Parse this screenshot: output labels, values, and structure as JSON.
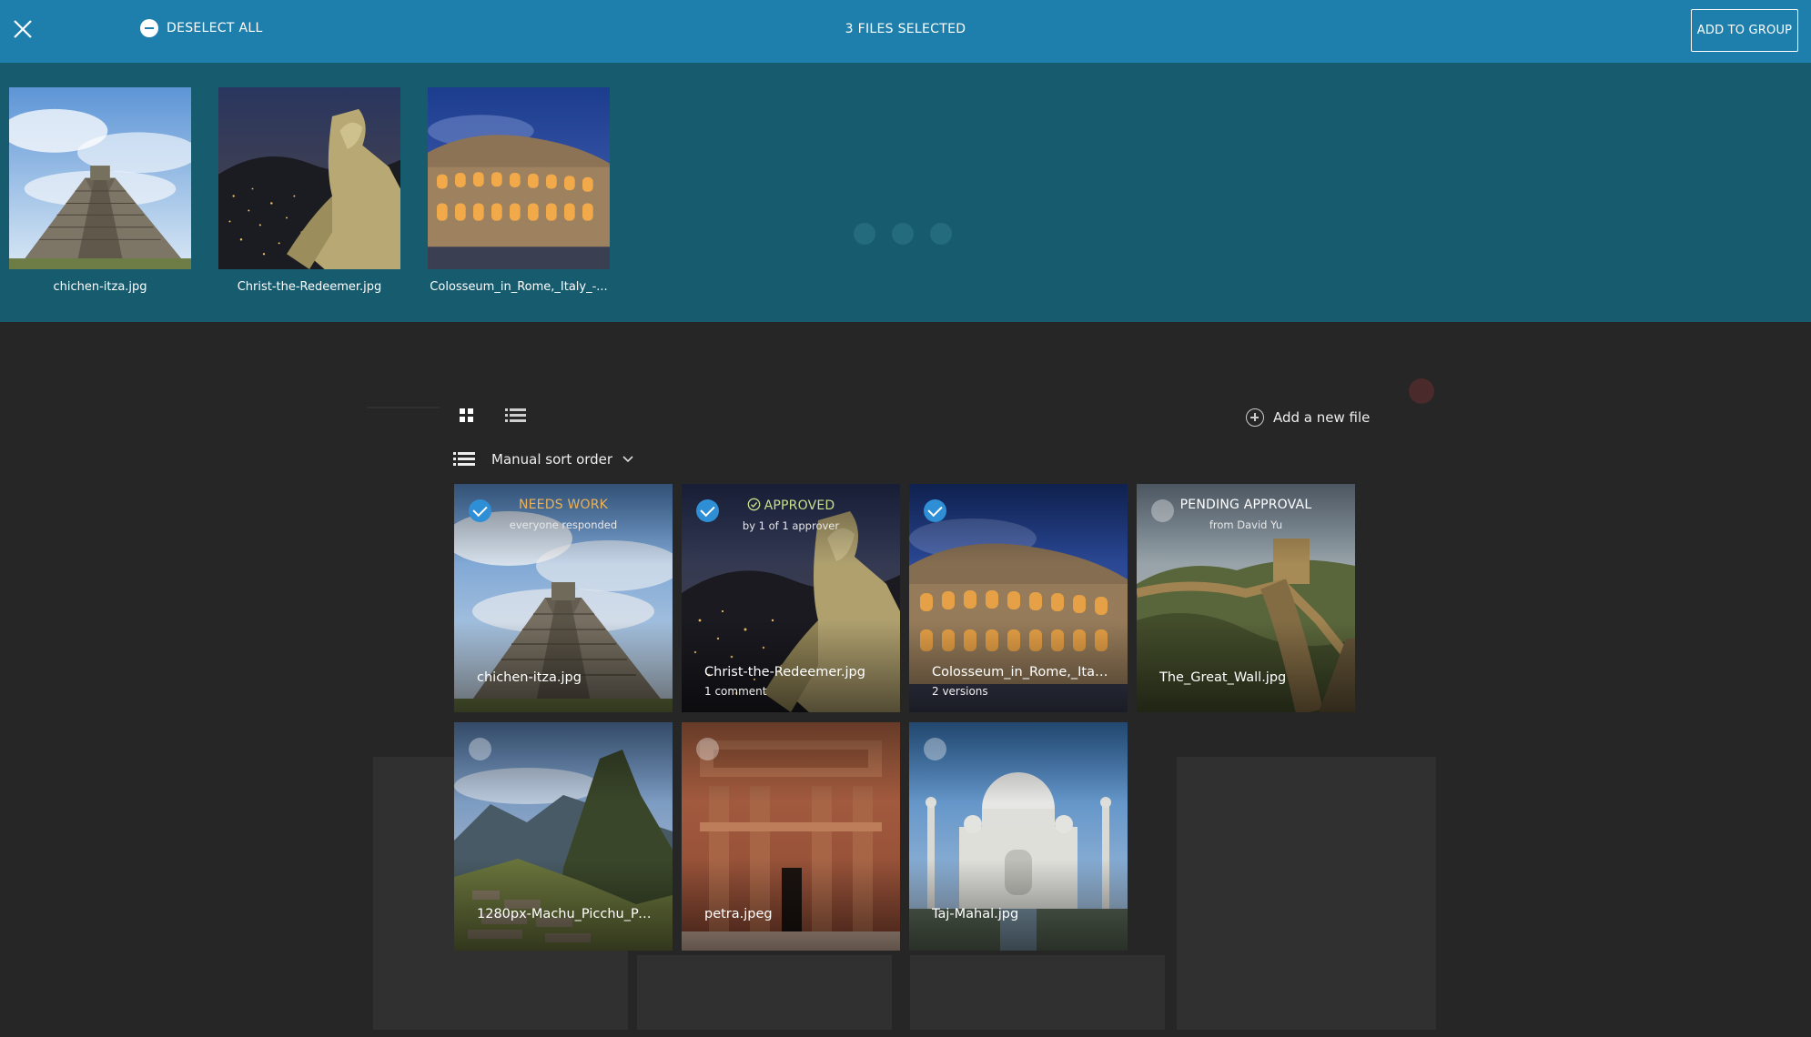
{
  "selection_bar": {
    "deselect_label": "DESELECT ALL",
    "count_label": "3 FILES SELECTED",
    "add_group_label": "ADD TO GROUP",
    "bar_color": "#1f7fac"
  },
  "tray": {
    "items": [
      {
        "name": "chichen-itza.jpg"
      },
      {
        "name": "Christ-the-Redeemer.jpg"
      },
      {
        "name": "Colosseum_in_Rome,_Italy_-..."
      }
    ]
  },
  "view": {
    "add_file_label": "Add a new file",
    "sort_label": "Manual sort order"
  },
  "files": [
    {
      "name": "chichen-itza.jpg",
      "selected": true,
      "status": "NEEDS WORK",
      "status_sub": "everyone responded",
      "meta": ""
    },
    {
      "name": "Christ-the-Redeemer.jpg",
      "selected": true,
      "status": "APPROVED",
      "status_sub": "by 1 of 1 approver",
      "meta": "1 comment"
    },
    {
      "name": "Colosseum_in_Rome,_Ital...",
      "selected": true,
      "status": "",
      "status_sub": "",
      "meta": "2 versions"
    },
    {
      "name": "The_Great_Wall.jpg",
      "selected": false,
      "status": "PENDING APPROVAL",
      "status_sub": "from David Yu",
      "meta": ""
    },
    {
      "name": "1280px-Machu_Picchu_Pe...",
      "selected": false,
      "status": "",
      "status_sub": "",
      "meta": ""
    },
    {
      "name": "petra.jpeg",
      "selected": false,
      "status": "",
      "status_sub": "",
      "meta": ""
    },
    {
      "name": "Taj-Mahal.jpg",
      "selected": false,
      "status": "",
      "status_sub": "",
      "meta": ""
    }
  ],
  "colors": {
    "accent": "#1f7fac",
    "needs_work": "#e9b25a",
    "approved": "#c7e08a",
    "check": "#2e8fd6",
    "tray_bg": "#175b6e"
  },
  "icons": {
    "close": "close-icon",
    "deselect": "minus-circle-icon",
    "grid": "grid-icon",
    "list": "list-icon",
    "add": "plus-circle-icon",
    "sort": "list-icon",
    "chevron": "chevron-down-icon",
    "approved": "check-circle-icon"
  }
}
